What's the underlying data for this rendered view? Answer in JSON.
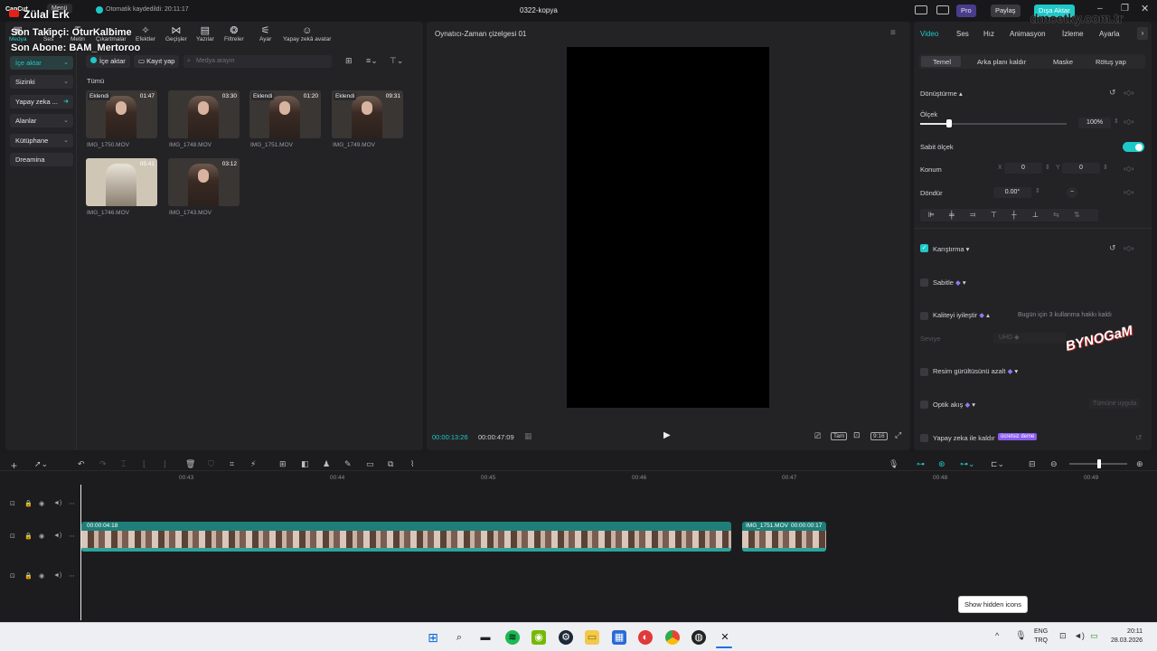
{
  "titlebar": {
    "app_name": "CapCut",
    "menu_label": "Menü",
    "autosave": "Otomatik kaydedildi: 20:11:17",
    "project_name": "0322-kopya",
    "pro_label": "Pro",
    "share_label": "Paylaş",
    "export_label": "Dışa Aktar"
  },
  "overlay": {
    "channel": "Zülal Erk",
    "last_follower": "Son Takipçi: OturKalbime",
    "last_sub": "Son Abone: BAM_Mertoroo",
    "watermark_url": "dmcetky.com.tr",
    "logo_text": "BYNOGaM"
  },
  "top_nav": [
    {
      "label": "Medya",
      "icon": "media-icon"
    },
    {
      "label": "Ses",
      "icon": "audio-icon"
    },
    {
      "label": "Metin",
      "icon": "text-icon"
    },
    {
      "label": "Çıkartmalar",
      "icon": "sticker-icon"
    },
    {
      "label": "Efektler",
      "icon": "effects-icon"
    },
    {
      "label": "Geçişler",
      "icon": "transitions-icon"
    },
    {
      "label": "Yazılar",
      "icon": "captions-icon"
    },
    {
      "label": "Filtreler",
      "icon": "filters-icon"
    },
    {
      "label": "Ayar",
      "icon": "adjust-icon"
    },
    {
      "label": "Yapay zekâ avatar",
      "icon": "ai-avatar-icon"
    }
  ],
  "sidebar": [
    {
      "label": "İçe aktar"
    },
    {
      "label": "Sizinki"
    },
    {
      "label": "Yapay zeka ..."
    },
    {
      "label": "Alanlar"
    },
    {
      "label": "Kütüphane"
    },
    {
      "label": "Dreamina"
    }
  ],
  "media": {
    "import_label": "İçe aktar",
    "record_label": "Kayıt yap",
    "search_placeholder": "Medya arayın",
    "all_label": "Tümü",
    "items": [
      {
        "badge": "Eklendi",
        "duration": "01:47",
        "name": "IMG_1750.MOV"
      },
      {
        "badge": "",
        "duration": "03:30",
        "name": "IMG_1748.MOV"
      },
      {
        "badge": "Eklendi",
        "duration": "01:20",
        "name": "IMG_1751.MOV"
      },
      {
        "badge": "Eklendi",
        "duration": "09:31",
        "name": "IMG_1749.MOV"
      },
      {
        "badge": "",
        "duration": "05:41",
        "name": "IMG_1746.MOV"
      },
      {
        "badge": "",
        "duration": "03:12",
        "name": "IMG_1743.MOV"
      }
    ]
  },
  "player": {
    "title": "Oynatıcı-Zaman çizelgesi 01",
    "current_time": "00:00:13:26",
    "total_time": "00:00:47:09",
    "full_label": "Tam",
    "ratio_label": "9:16"
  },
  "inspector": {
    "tabs": [
      "Video",
      "Ses",
      "Hız",
      "Animasyon",
      "İzleme",
      "Ayarla"
    ],
    "subtabs": [
      "Temel",
      "Arka planı kaldır",
      "Maske",
      "Rötuş yap"
    ],
    "transform_label": "Dönüştürme",
    "scale_label": "Ölçek",
    "scale_value": "100%",
    "scale_level": 0.2,
    "uniform_label": "Sabit ölçek",
    "position_label": "Konum",
    "x_label": "X",
    "x_value": "0",
    "y_label": "Y",
    "y_value": "0",
    "rotate_label": "Döndür",
    "rotate_value": "0.00°",
    "blend_label": "Karıştırma",
    "stabilize_label": "Sabitle",
    "enhance_label": "Kaliteyi iyileştir",
    "enhance_note": "Bugün için 3 kullanma hakkı kaldı",
    "level_label": "Seviye",
    "level_value": "UHD",
    "denoise_label": "Resim gürültüsünü azalt",
    "optical_label": "Optik akış",
    "apply_all_label": "Tümüne uygula",
    "ai_remove_label": "Yapay zeka ile kaldır",
    "free_demo_label": "ücretsiz deme"
  },
  "timeline": {
    "ruler": [
      "00:43",
      "00:44",
      "00:45",
      "00:46",
      "00:47",
      "00:48",
      "00:49"
    ],
    "clip1_time": "00:00:04:18",
    "clip2_name": "IMG_1751.MOV",
    "clip2_time": "00:00:00:17"
  },
  "tooltip": "Show hidden icons",
  "tray": {
    "lang_top": "ENG",
    "lang_bottom": "TRQ",
    "time": "20:11",
    "date": "28.03.2026"
  },
  "colors": {
    "accent": "#1fc8c8",
    "track": "#1e7f7a",
    "pro": "#6b4fd6"
  }
}
